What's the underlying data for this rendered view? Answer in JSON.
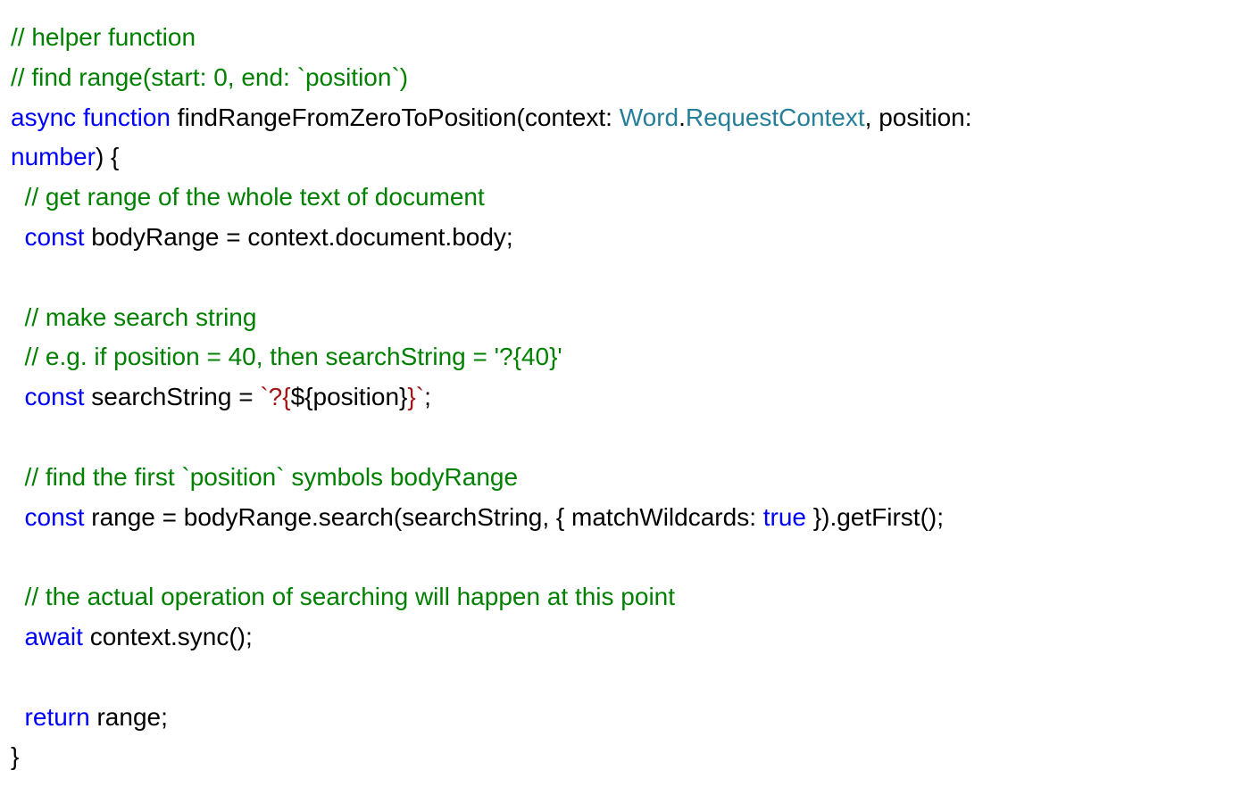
{
  "code": {
    "line1": "// helper function",
    "line2": "// find range(start: 0, end: `position`)",
    "line3_async": "async ",
    "line3_function": "function",
    "line3_name": " findRangeFromZeroToPosition(context: ",
    "line3_type1": "Word",
    "line3_dot": ".",
    "line3_type2": "RequestContext",
    "line3_after": ", position: ",
    "line4_type": "number",
    "line4_after": ") {",
    "line5": "  // get range of the whole text of document",
    "line6_const": "  const",
    "line6_after": " bodyRange = context.document.body;",
    "line7": "",
    "line8": "  // make search string",
    "line9": "  // e.g. if position = 40, then searchString = '?{40}'",
    "line10_const": "  const",
    "line10_name": " searchString = ",
    "line10_str1": "`?{",
    "line10_interp": "${position}",
    "line10_str2": "}`",
    "line10_semi": ";",
    "line11": "",
    "line12": "  // find the first `position` symbols bodyRange",
    "line13_const": "  const",
    "line13_name": " range = bodyRange.search(searchString, { matchWildcards: ",
    "line13_true": "true",
    "line13_after": " }).getFirst();",
    "line14": "",
    "line15": "  // the actual operation of searching will happen at this point",
    "line16_await": "  await",
    "line16_after": " context.sync();",
    "line17": "",
    "line18_return": "  return",
    "line18_after": " range;",
    "line19": "}"
  }
}
